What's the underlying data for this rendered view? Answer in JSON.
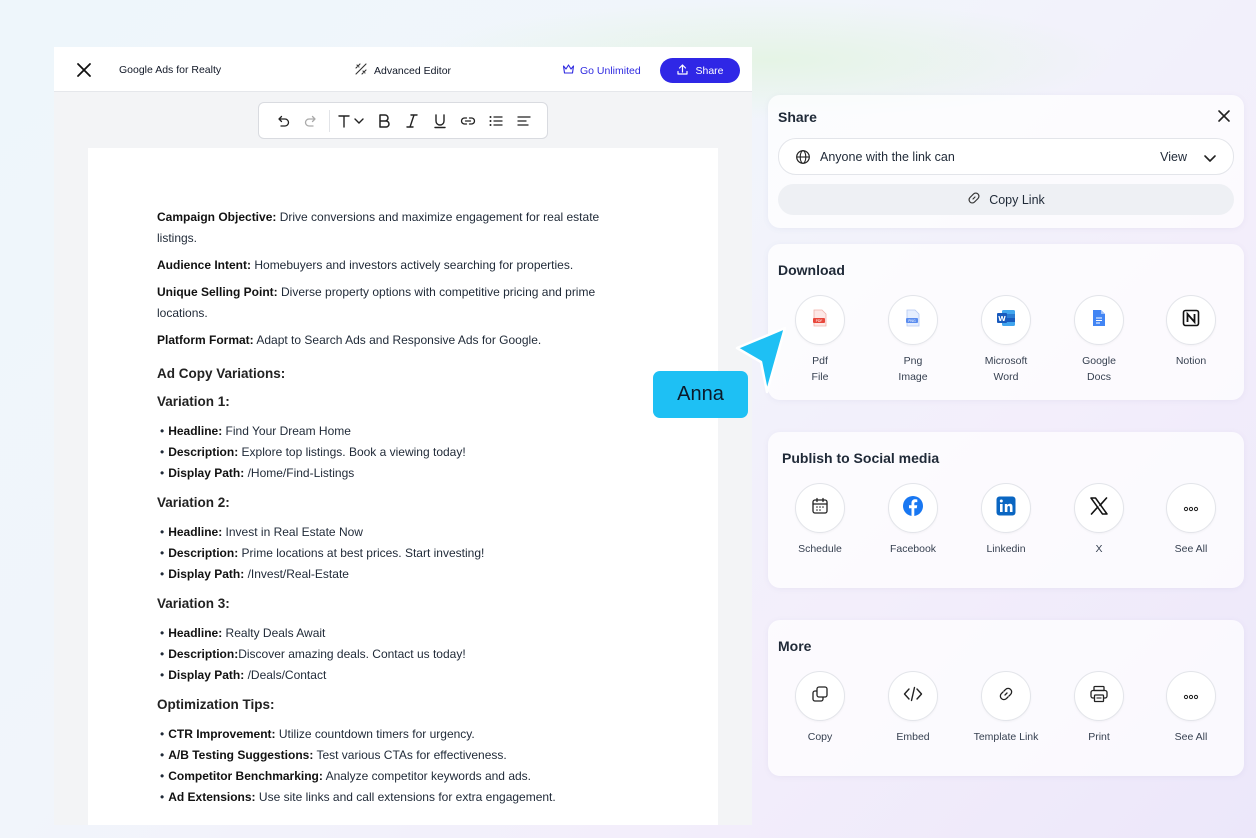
{
  "editor": {
    "doc_title": "Google Ads for Realty",
    "advanced_editor_label": "Advanced Editor",
    "go_unlimited_label": "Go Unlimited",
    "share_label": "Share"
  },
  "document": {
    "intro": [
      {
        "label": "Campaign Objective:",
        "text": " Drive conversions and maximize engagement for real estate listings."
      },
      {
        "label": "Audience Intent:",
        "text": " Homebuyers and investors actively searching for properties."
      },
      {
        "label": "Unique Selling Point:",
        "text": " Diverse property options with competitive pricing and prime locations."
      },
      {
        "label": "Platform Format:",
        "text": " Adapt to Search Ads and Responsive Ads for Google."
      }
    ],
    "section_heading": "Ad Copy Variations:",
    "variations": [
      {
        "title": "Variation 1:",
        "items": [
          {
            "label": "Headline:",
            "text": " Find Your Dream Home"
          },
          {
            "label": "Description:",
            "text": " Explore top listings. Book a viewing today!"
          },
          {
            "label": "Display Path:",
            "text": " /Home/Find-Listings"
          }
        ]
      },
      {
        "title": "Variation 2:",
        "items": [
          {
            "label": "Headline:",
            "text": " Invest in Real Estate Now"
          },
          {
            "label": "Description:",
            "text": " Prime locations at best prices. Start investing!"
          },
          {
            "label": "Display Path:",
            "text": " /Invest/Real-Estate"
          }
        ]
      },
      {
        "title": "Variation 3:",
        "items": [
          {
            "label": "Headline:",
            "text": " Realty Deals Await"
          },
          {
            "label": "Description:",
            "text": "Discover amazing deals. Contact us today!"
          },
          {
            "label": "Display Path:",
            "text": " /Deals/Contact"
          }
        ]
      }
    ],
    "tips_heading": "Optimization Tips:",
    "tips": [
      {
        "label": "CTR Improvement:",
        "text": " Utilize countdown timers for urgency."
      },
      {
        "label": "A/B Testing Suggestions:",
        "text": " Test various CTAs for effectiveness."
      },
      {
        "label": "Competitor Benchmarking:",
        "text": " Analyze competitor keywords and ads."
      },
      {
        "label": "Ad Extensions:",
        "text": " Use site links and call extensions for extra engagement."
      }
    ]
  },
  "collaborator": {
    "name": "Anna",
    "color": "#1ec0f4"
  },
  "share_panel": {
    "title": "Share",
    "permission_text": "Anyone with the link can",
    "permission_role": "View",
    "copy_link_label": "Copy Link"
  },
  "download_panel": {
    "title": "Download",
    "items": [
      {
        "line1": "Pdf",
        "line2": "File",
        "icon": "pdf-file-icon"
      },
      {
        "line1": "Png",
        "line2": "Image",
        "icon": "png-image-icon"
      },
      {
        "line1": "Microsoft",
        "line2": "Word",
        "icon": "microsoft-word-icon"
      },
      {
        "line1": "Google",
        "line2": "Docs",
        "icon": "google-docs-icon"
      },
      {
        "line1": "Notion",
        "line2": "",
        "icon": "notion-icon"
      }
    ]
  },
  "social_panel": {
    "title": "Publish to Social media",
    "items": [
      {
        "label": "Schedule",
        "icon": "calendar-icon"
      },
      {
        "label": "Facebook",
        "icon": "facebook-icon"
      },
      {
        "label": "Linkedin",
        "icon": "linkedin-icon"
      },
      {
        "label": "X",
        "icon": "x-icon"
      },
      {
        "label": "See All",
        "icon": "more-icon"
      }
    ]
  },
  "more_panel": {
    "title": "More",
    "items": [
      {
        "label": "Copy",
        "icon": "copy-icon"
      },
      {
        "label": "Embed",
        "icon": "code-icon"
      },
      {
        "label": "Template Link",
        "icon": "link-icon"
      },
      {
        "label": "Print",
        "icon": "printer-icon"
      },
      {
        "label": "See All",
        "icon": "more-icon"
      }
    ]
  },
  "colors": {
    "primary": "#2f27e6",
    "accent": "#1ec0f4"
  }
}
